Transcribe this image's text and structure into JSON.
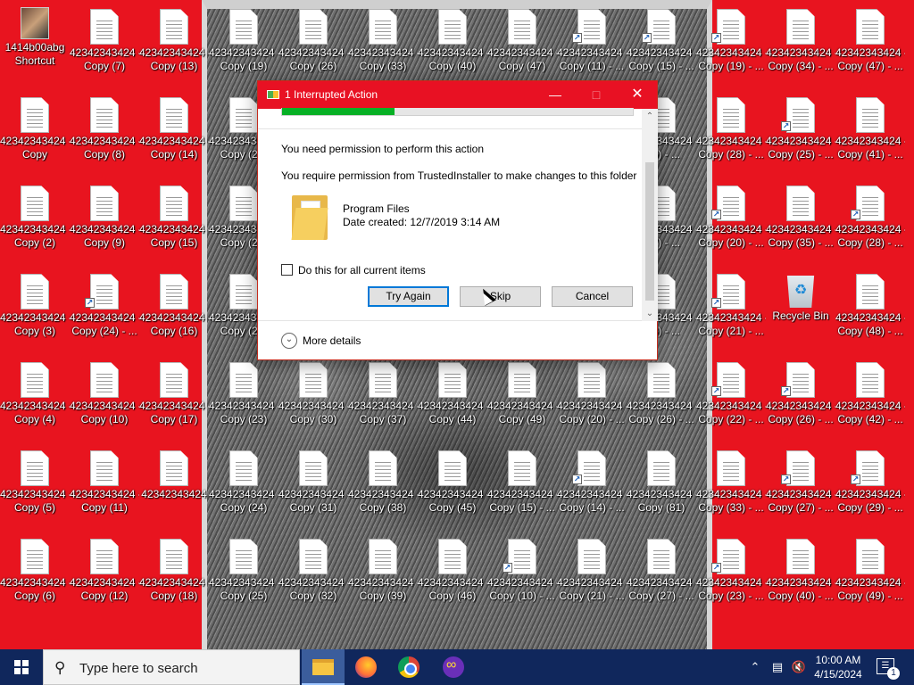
{
  "desktop": {
    "icons": [
      {
        "l1": "1414b00abg",
        "l2": "Shortcut",
        "kind": "thumb"
      },
      {
        "l1": "42342343424 -",
        "l2": "Copy (7)"
      },
      {
        "l1": "42342343424 -",
        "l2": "Copy (13)"
      },
      {
        "l1": "42342343424 -",
        "l2": "Copy (19)"
      },
      {
        "l1": "42342343424 -",
        "l2": "Copy (26)"
      },
      {
        "l1": "42342343424 -",
        "l2": "Copy (33)"
      },
      {
        "l1": "42342343424 -",
        "l2": "Copy (40)"
      },
      {
        "l1": "42342343424 -",
        "l2": "Copy (47)"
      },
      {
        "l1": "42342343424 -",
        "l2": "Copy (11) - ...",
        "shortcut": true
      },
      {
        "l1": "42342343424 -",
        "l2": "Copy (15) - ...",
        "shortcut": true
      },
      {
        "l1": "42342343424 -",
        "l2": "Copy (19) - ...",
        "shortcut": true
      },
      {
        "l1": "42342343424 -",
        "l2": "Copy (34) - ..."
      },
      {
        "l1": "42342343424 -",
        "l2": "Copy (47) - ..."
      },
      {
        "l1": "42342343424 -",
        "l2": "Copy"
      },
      {
        "l1": "42342343424 -",
        "l2": "Copy (8)"
      },
      {
        "l1": "42342343424 -",
        "l2": "Copy (14)"
      },
      {
        "l1": "42342343424 -",
        "l2": "Copy (20)"
      },
      {
        "l1": "42342343424 -",
        "l2": "(16) - ..."
      },
      {
        "l1": "42342343424 -",
        "l2": "Copy (28) - ..."
      },
      {
        "l1": "42342343424 -",
        "l2": "Copy (25) - ...",
        "shortcut": true
      },
      {
        "l1": "42342343424 -",
        "l2": "Copy (41) - ..."
      },
      {
        "l1": "42342343424 -",
        "l2": "Copy (2)"
      },
      {
        "l1": "42342343424 -",
        "l2": "Copy (9)"
      },
      {
        "l1": "42342343424 -",
        "l2": "Copy (15)"
      },
      {
        "l1": "42342343424 -",
        "l2": "Copy (21)"
      },
      {
        "l1": "42342343424 -",
        "l2": "(17) - ..."
      },
      {
        "l1": "42342343424 -",
        "l2": "Copy (20) - ...",
        "shortcut": true
      },
      {
        "l1": "42342343424 -",
        "l2": "Copy (35) - ..."
      },
      {
        "l1": "42342343424 -",
        "l2": "Copy (28) - ...",
        "shortcut": true
      },
      {
        "l1": "42342343424 -",
        "l2": "Copy (3)"
      },
      {
        "l1": "42342343424 -",
        "l2": "Copy (24) - ...",
        "shortcut": true
      },
      {
        "l1": "42342343424 -",
        "l2": "Copy (16)"
      },
      {
        "l1": "42342343424 -",
        "l2": "Copy (22)"
      },
      {
        "l1": "42342343424 -",
        "l2": "(18) - ..."
      },
      {
        "l1": "42342343424 -",
        "l2": "Copy (21) - ...",
        "shortcut": true
      },
      {
        "l1": "Recycle Bin",
        "l2": "",
        "kind": "bin"
      },
      {
        "l1": "42342343424 -",
        "l2": "Copy (48) - ..."
      },
      {
        "l1": "42342343424 -",
        "l2": "Copy (4)"
      },
      {
        "l1": "42342343424 -",
        "l2": "Copy (10)"
      },
      {
        "l1": "42342343424 -",
        "l2": "Copy (17)"
      },
      {
        "l1": "42342343424 -",
        "l2": "Copy (23)"
      },
      {
        "l1": "42342343424 -",
        "l2": "Copy (30)"
      },
      {
        "l1": "42342343424 -",
        "l2": "Copy (37)"
      },
      {
        "l1": "42342343424 -",
        "l2": "Copy (44)"
      },
      {
        "l1": "42342343424 -",
        "l2": "Copy (49)"
      },
      {
        "l1": "42342343424 -",
        "l2": "Copy (20) - ..."
      },
      {
        "l1": "42342343424 -",
        "l2": "Copy (26) - ..."
      },
      {
        "l1": "42342343424 -",
        "l2": "Copy (22) - ...",
        "shortcut": true
      },
      {
        "l1": "42342343424 -",
        "l2": "Copy (26) - ...",
        "shortcut": true
      },
      {
        "l1": "42342343424 -",
        "l2": "Copy (42) - ..."
      },
      {
        "l1": "42342343424 -",
        "l2": "Copy (5)"
      },
      {
        "l1": "42342343424 -",
        "l2": "Copy (11)"
      },
      {
        "l1": "42342343424",
        "l2": ""
      },
      {
        "l1": "42342343424 -",
        "l2": "Copy (24)"
      },
      {
        "l1": "42342343424 -",
        "l2": "Copy (31)"
      },
      {
        "l1": "42342343424 -",
        "l2": "Copy (38)"
      },
      {
        "l1": "42342343424 -",
        "l2": "Copy (45)"
      },
      {
        "l1": "42342343424 -",
        "l2": "Copy (15) - ..."
      },
      {
        "l1": "42342343424 -",
        "l2": "Copy (14) - ...",
        "shortcut": true
      },
      {
        "l1": "42342343424 -",
        "l2": "Copy (81)"
      },
      {
        "l1": "42342343424 -",
        "l2": "Copy (33) - ..."
      },
      {
        "l1": "42342343424 -",
        "l2": "Copy (27) - ...",
        "shortcut": true
      },
      {
        "l1": "42342343424 -",
        "l2": "Copy (29) - ...",
        "shortcut": true
      },
      {
        "l1": "42342343424 -",
        "l2": "Copy (6)"
      },
      {
        "l1": "42342343424 -",
        "l2": "Copy (12)"
      },
      {
        "l1": "42342343424 -",
        "l2": "Copy (18)"
      },
      {
        "l1": "42342343424 -",
        "l2": "Copy (25)"
      },
      {
        "l1": "42342343424 -",
        "l2": "Copy (32)"
      },
      {
        "l1": "42342343424 -",
        "l2": "Copy (39)"
      },
      {
        "l1": "42342343424 -",
        "l2": "Copy (46)"
      },
      {
        "l1": "42342343424 -",
        "l2": "Copy (10) - ...",
        "shortcut": true
      },
      {
        "l1": "42342343424 -",
        "l2": "Copy (21) - ..."
      },
      {
        "l1": "42342343424 -",
        "l2": "Copy (27) - ..."
      },
      {
        "l1": "42342343424 -",
        "l2": "Copy (23) - ...",
        "shortcut": true
      },
      {
        "l1": "42342343424 -",
        "l2": "Copy (40) - ..."
      },
      {
        "l1": "42342343424 -",
        "l2": "Copy (49) - ..."
      }
    ]
  },
  "dialog": {
    "title": "1 Interrupted Action",
    "progress_fraction": 0.32,
    "heading": "You need permission to perform this action",
    "detail": "You require permission from TrustedInstaller to make changes to this folder",
    "item_name": "Program Files",
    "item_date": "Date created: 12/7/2019 3:14 AM",
    "checkbox_label": "Do this for all current items",
    "checkbox_checked": false,
    "buttons": {
      "try_again": "Try Again",
      "skip": "Skip",
      "cancel": "Cancel"
    },
    "more_details": "More details",
    "icons": {
      "title_icon": "file-copy-icon",
      "folder_icon": "folder-icon",
      "more_icon": "chevron-down-icon"
    }
  },
  "taskbar": {
    "search_placeholder": "Type here to search",
    "apps": [
      "file-explorer-icon",
      "firefox-icon",
      "chrome-icon",
      "mask-app-icon"
    ],
    "clock_time": "10:00 AM",
    "clock_date": "4/15/2024",
    "notification_count": "1",
    "colors": {
      "taskbar": "#10275c",
      "accent": "#e81123"
    }
  }
}
